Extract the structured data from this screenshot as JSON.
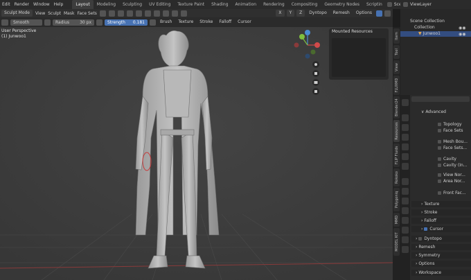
{
  "menubar": {
    "items": [
      "Edit",
      "Render",
      "Window",
      "Help"
    ],
    "workspaces": [
      "Layout",
      "Modeling",
      "Sculpting",
      "UV Editing",
      "Texture Paint",
      "Shading",
      "Animation",
      "Rendering",
      "Compositing",
      "Geometry Nodes",
      "Scriptin"
    ],
    "active_workspace": "Layout",
    "scene": "Scene",
    "viewlayer": "ViewLayer"
  },
  "header": {
    "mode": "Sculpt Mode",
    "menus": [
      "View",
      "Sculpt",
      "Mask",
      "Face Sets"
    ],
    "xyz": [
      "X",
      "Y",
      "Z"
    ],
    "dyntopo": "Dyntopo",
    "remesh": "Remesh",
    "options": "Options"
  },
  "tool": {
    "brush_name": "Smooth",
    "radius_label": "Radius",
    "radius_value": "30 px",
    "strength_label": "Strength",
    "strength_value": "0.181",
    "menus": [
      "Brush",
      "Texture",
      "Stroke",
      "Falloff",
      "Cursor"
    ]
  },
  "viewport": {
    "view_name": "User Perspective",
    "object_name": "(1) Junwoo1"
  },
  "mounted": {
    "title": "Mounted Resources"
  },
  "sidetabs": [
    "Item",
    "Tool",
    "View",
    "FLUXMD",
    "Blender24",
    "Resources",
    "FLIP Fluids",
    "Rokoko",
    "Polygoniq",
    "MMD",
    "MODEL KIT"
  ],
  "outliner": {
    "root": "Scene Collection",
    "collection": "Collection",
    "object": "Junwoo1"
  },
  "properties": {
    "rows": [
      {
        "label": "Advanced",
        "kind": "section"
      },
      {
        "label": "Topology",
        "kind": "check"
      },
      {
        "label": "Face Sets",
        "kind": "check"
      },
      {
        "label": "Mesh Bou...",
        "kind": "check"
      },
      {
        "label": "Face Sets...",
        "kind": "check"
      },
      {
        "label": "Cavity",
        "kind": "check"
      },
      {
        "label": "Cavity (In...",
        "kind": "check"
      },
      {
        "label": "View Nor...",
        "kind": "check"
      },
      {
        "label": "Area Nor...",
        "kind": "check"
      },
      {
        "label": "Front Fac...",
        "kind": "check"
      },
      {
        "label": "Texture",
        "kind": "section"
      },
      {
        "label": "Stroke",
        "kind": "section"
      },
      {
        "label": "Falloff",
        "kind": "section"
      },
      {
        "label": "Cursor",
        "kind": "section-check"
      },
      {
        "label": "Dyntopo",
        "kind": "section-check-off"
      },
      {
        "label": "Remesh",
        "kind": "section"
      },
      {
        "label": "Symmetry",
        "kind": "section"
      },
      {
        "label": "Options",
        "kind": "section"
      },
      {
        "label": "Workspace",
        "kind": "section"
      }
    ]
  },
  "colors": {
    "accent": "#4772b3",
    "brush_circle": "#c83a3a",
    "axis_x": "#d24a4a",
    "axis_y": "#7fbf3f",
    "axis_z": "#4a8ad2",
    "header": "#2b2b2b",
    "viewport": "#3d3d3d"
  }
}
